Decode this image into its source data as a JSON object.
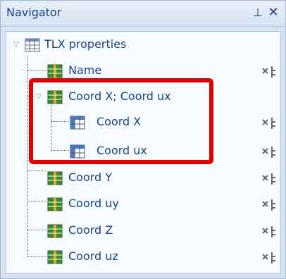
{
  "panel": {
    "title": "Navigator",
    "pin_icon": "pin-icon",
    "close_icon": "close-icon"
  },
  "tree": {
    "root": {
      "label": "TLX properties",
      "icon": "table-icon",
      "expanded": true
    },
    "items": [
      {
        "label": "Name",
        "icon": "table-green-icon"
      },
      {
        "label": "Coord X; Coord ux",
        "icon": "table-green-icon",
        "expanded": true,
        "children": [
          {
            "label": "Coord X",
            "icon": "table-blue-icon"
          },
          {
            "label": "Coord ux",
            "icon": "table-blue-icon"
          }
        ]
      },
      {
        "label": "Coord Y",
        "icon": "table-green-icon"
      },
      {
        "label": "Coord uy",
        "icon": "table-green-icon"
      },
      {
        "label": "Coord Z",
        "icon": "table-green-icon"
      },
      {
        "label": "Coord uz",
        "icon": "table-green-icon"
      }
    ]
  },
  "colors": {
    "title_text": "#15428b",
    "highlight": "#e00000",
    "panel_bg": "#d7e3f2",
    "tree_bg": "#f8fbff"
  }
}
